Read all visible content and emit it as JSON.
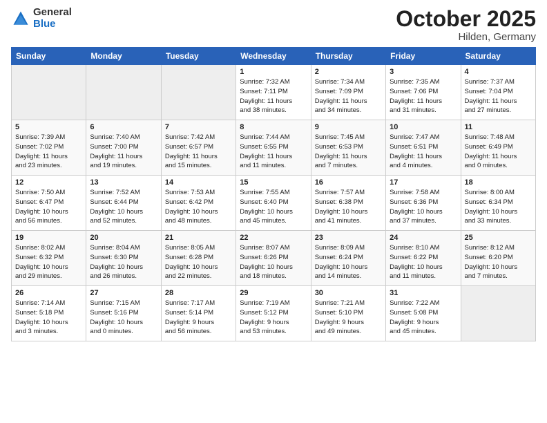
{
  "logo": {
    "general": "General",
    "blue": "Blue"
  },
  "title": {
    "month": "October 2025",
    "location": "Hilden, Germany"
  },
  "weekdays": [
    "Sunday",
    "Monday",
    "Tuesday",
    "Wednesday",
    "Thursday",
    "Friday",
    "Saturday"
  ],
  "weeks": [
    [
      {
        "day": "",
        "info": ""
      },
      {
        "day": "",
        "info": ""
      },
      {
        "day": "",
        "info": ""
      },
      {
        "day": "1",
        "info": "Sunrise: 7:32 AM\nSunset: 7:11 PM\nDaylight: 11 hours\nand 38 minutes."
      },
      {
        "day": "2",
        "info": "Sunrise: 7:34 AM\nSunset: 7:09 PM\nDaylight: 11 hours\nand 34 minutes."
      },
      {
        "day": "3",
        "info": "Sunrise: 7:35 AM\nSunset: 7:06 PM\nDaylight: 11 hours\nand 31 minutes."
      },
      {
        "day": "4",
        "info": "Sunrise: 7:37 AM\nSunset: 7:04 PM\nDaylight: 11 hours\nand 27 minutes."
      }
    ],
    [
      {
        "day": "5",
        "info": "Sunrise: 7:39 AM\nSunset: 7:02 PM\nDaylight: 11 hours\nand 23 minutes."
      },
      {
        "day": "6",
        "info": "Sunrise: 7:40 AM\nSunset: 7:00 PM\nDaylight: 11 hours\nand 19 minutes."
      },
      {
        "day": "7",
        "info": "Sunrise: 7:42 AM\nSunset: 6:57 PM\nDaylight: 11 hours\nand 15 minutes."
      },
      {
        "day": "8",
        "info": "Sunrise: 7:44 AM\nSunset: 6:55 PM\nDaylight: 11 hours\nand 11 minutes."
      },
      {
        "day": "9",
        "info": "Sunrise: 7:45 AM\nSunset: 6:53 PM\nDaylight: 11 hours\nand 7 minutes."
      },
      {
        "day": "10",
        "info": "Sunrise: 7:47 AM\nSunset: 6:51 PM\nDaylight: 11 hours\nand 4 minutes."
      },
      {
        "day": "11",
        "info": "Sunrise: 7:48 AM\nSunset: 6:49 PM\nDaylight: 11 hours\nand 0 minutes."
      }
    ],
    [
      {
        "day": "12",
        "info": "Sunrise: 7:50 AM\nSunset: 6:47 PM\nDaylight: 10 hours\nand 56 minutes."
      },
      {
        "day": "13",
        "info": "Sunrise: 7:52 AM\nSunset: 6:44 PM\nDaylight: 10 hours\nand 52 minutes."
      },
      {
        "day": "14",
        "info": "Sunrise: 7:53 AM\nSunset: 6:42 PM\nDaylight: 10 hours\nand 48 minutes."
      },
      {
        "day": "15",
        "info": "Sunrise: 7:55 AM\nSunset: 6:40 PM\nDaylight: 10 hours\nand 45 minutes."
      },
      {
        "day": "16",
        "info": "Sunrise: 7:57 AM\nSunset: 6:38 PM\nDaylight: 10 hours\nand 41 minutes."
      },
      {
        "day": "17",
        "info": "Sunrise: 7:58 AM\nSunset: 6:36 PM\nDaylight: 10 hours\nand 37 minutes."
      },
      {
        "day": "18",
        "info": "Sunrise: 8:00 AM\nSunset: 6:34 PM\nDaylight: 10 hours\nand 33 minutes."
      }
    ],
    [
      {
        "day": "19",
        "info": "Sunrise: 8:02 AM\nSunset: 6:32 PM\nDaylight: 10 hours\nand 29 minutes."
      },
      {
        "day": "20",
        "info": "Sunrise: 8:04 AM\nSunset: 6:30 PM\nDaylight: 10 hours\nand 26 minutes."
      },
      {
        "day": "21",
        "info": "Sunrise: 8:05 AM\nSunset: 6:28 PM\nDaylight: 10 hours\nand 22 minutes."
      },
      {
        "day": "22",
        "info": "Sunrise: 8:07 AM\nSunset: 6:26 PM\nDaylight: 10 hours\nand 18 minutes."
      },
      {
        "day": "23",
        "info": "Sunrise: 8:09 AM\nSunset: 6:24 PM\nDaylight: 10 hours\nand 14 minutes."
      },
      {
        "day": "24",
        "info": "Sunrise: 8:10 AM\nSunset: 6:22 PM\nDaylight: 10 hours\nand 11 minutes."
      },
      {
        "day": "25",
        "info": "Sunrise: 8:12 AM\nSunset: 6:20 PM\nDaylight: 10 hours\nand 7 minutes."
      }
    ],
    [
      {
        "day": "26",
        "info": "Sunrise: 7:14 AM\nSunset: 5:18 PM\nDaylight: 10 hours\nand 3 minutes."
      },
      {
        "day": "27",
        "info": "Sunrise: 7:15 AM\nSunset: 5:16 PM\nDaylight: 10 hours\nand 0 minutes."
      },
      {
        "day": "28",
        "info": "Sunrise: 7:17 AM\nSunset: 5:14 PM\nDaylight: 9 hours\nand 56 minutes."
      },
      {
        "day": "29",
        "info": "Sunrise: 7:19 AM\nSunset: 5:12 PM\nDaylight: 9 hours\nand 53 minutes."
      },
      {
        "day": "30",
        "info": "Sunrise: 7:21 AM\nSunset: 5:10 PM\nDaylight: 9 hours\nand 49 minutes."
      },
      {
        "day": "31",
        "info": "Sunrise: 7:22 AM\nSunset: 5:08 PM\nDaylight: 9 hours\nand 45 minutes."
      },
      {
        "day": "",
        "info": ""
      }
    ]
  ]
}
